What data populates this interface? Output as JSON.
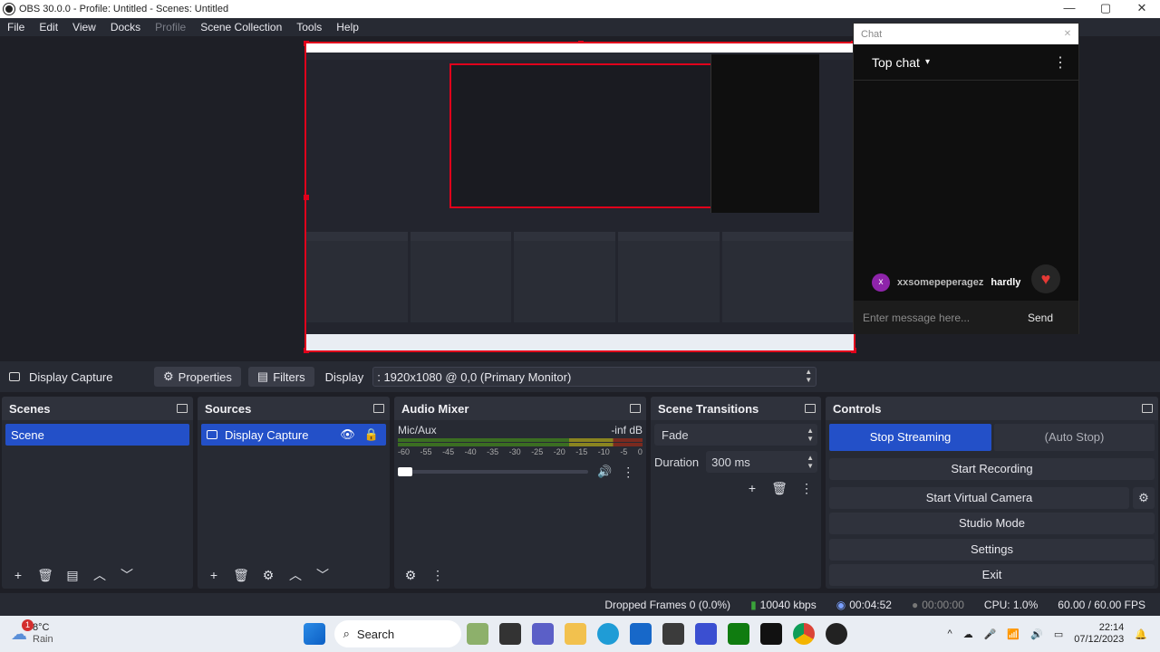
{
  "window": {
    "title": "OBS 30.0.0 - Profile: Untitled - Scenes: Untitled",
    "min": "—",
    "max": "▢",
    "close": "✕"
  },
  "menu": [
    "File",
    "Edit",
    "View",
    "Docks",
    "Profile",
    "Scene Collection",
    "Tools",
    "Help"
  ],
  "chat": {
    "window_title": "Chat",
    "header": "Top chat",
    "message": {
      "avatar_letter": "x",
      "user": "xxsomepeperagez",
      "text": "hardly"
    },
    "input_placeholder": "Enter message here...",
    "send": "Send",
    "colors": {
      "avatar": "#8e24aa",
      "heart": "#e53935"
    }
  },
  "source_bar": {
    "selected": "Display Capture",
    "properties": "Properties",
    "filters": "Filters",
    "display_label": "Display",
    "display_value": ": 1920x1080 @ 0,0 (Primary Monitor)"
  },
  "scenes": {
    "title": "Scenes",
    "items": [
      "Scene"
    ]
  },
  "sources": {
    "title": "Sources",
    "items": [
      "Display Capture"
    ]
  },
  "mixer": {
    "title": "Audio Mixer",
    "channel": "Mic/Aux",
    "level": "-inf dB",
    "ticks": [
      "-60",
      "-55",
      "-45",
      "-40",
      "-35",
      "-30",
      "-25",
      "-20",
      "-15",
      "-10",
      "-5",
      "0"
    ]
  },
  "transitions": {
    "title": "Scene Transitions",
    "type": "Fade",
    "duration_label": "Duration",
    "duration": "300 ms"
  },
  "controls": {
    "title": "Controls",
    "stop_streaming": "Stop Streaming",
    "auto_stop": "(Auto Stop)",
    "start_recording": "Start Recording",
    "start_virtual_camera": "Start Virtual Camera",
    "studio_mode": "Studio Mode",
    "settings": "Settings",
    "exit": "Exit",
    "accent": "#2350c8"
  },
  "status": {
    "dropped": "Dropped Frames 0 (0.0%)",
    "bitrate": "10040 kbps",
    "stream_time": "00:04:52",
    "rec_time": "00:00:00",
    "cpu": "CPU: 1.0%",
    "fps": "60.00 / 60.00 FPS"
  },
  "taskbar": {
    "weather_temp": "8°C",
    "weather_desc": "Rain",
    "weather_badge": "1",
    "search": "Search",
    "time": "22:14",
    "date": "07/12/2023"
  }
}
